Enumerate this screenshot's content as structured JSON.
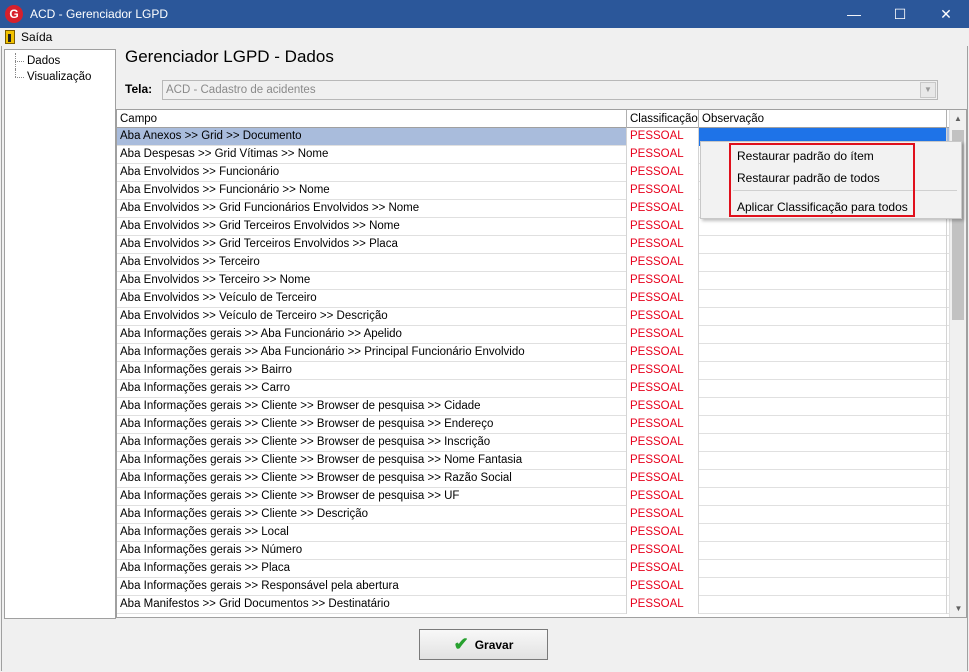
{
  "window": {
    "title": "ACD - Gerenciador LGPD",
    "minimize_glyph": "—",
    "maximize_glyph": "☐",
    "close_glyph": "✕"
  },
  "menu": {
    "exit_label": "Saída"
  },
  "tree": {
    "items": [
      "Dados",
      "Visualização"
    ]
  },
  "header": {
    "title": "Gerenciador LGPD - Dados",
    "tela_label": "Tela:",
    "tela_value": "ACD - Cadastro de acidentes"
  },
  "grid": {
    "columns": [
      "Campo",
      "Classificação",
      "Observação"
    ],
    "rows": [
      {
        "campo": "Aba Anexos >> Grid >> Documento",
        "classificacao": "PESSOAL",
        "observacao": ""
      },
      {
        "campo": "Aba Despesas >> Grid Vítimas >> Nome",
        "classificacao": "PESSOAL",
        "observacao": ""
      },
      {
        "campo": "Aba Envolvidos >> Funcionário",
        "classificacao": "PESSOAL",
        "observacao": ""
      },
      {
        "campo": "Aba Envolvidos >> Funcionário >> Nome",
        "classificacao": "PESSOAL",
        "observacao": ""
      },
      {
        "campo": "Aba Envolvidos >> Grid Funcionários Envolvidos >> Nome",
        "classificacao": "PESSOAL",
        "observacao": ""
      },
      {
        "campo": "Aba Envolvidos >> Grid Terceiros Envolvidos >> Nome",
        "classificacao": "PESSOAL",
        "observacao": ""
      },
      {
        "campo": "Aba Envolvidos >> Grid Terceiros Envolvidos >> Placa",
        "classificacao": "PESSOAL",
        "observacao": ""
      },
      {
        "campo": "Aba Envolvidos >> Terceiro",
        "classificacao": "PESSOAL",
        "observacao": ""
      },
      {
        "campo": "Aba Envolvidos >> Terceiro >> Nome",
        "classificacao": "PESSOAL",
        "observacao": ""
      },
      {
        "campo": "Aba Envolvidos >> Veículo de Terceiro",
        "classificacao": "PESSOAL",
        "observacao": ""
      },
      {
        "campo": "Aba Envolvidos >> Veículo de Terceiro >> Descrição",
        "classificacao": "PESSOAL",
        "observacao": ""
      },
      {
        "campo": "Aba Informações gerais >> Aba Funcionário >> Apelido",
        "classificacao": "PESSOAL",
        "observacao": ""
      },
      {
        "campo": "Aba Informações gerais >> Aba Funcionário >> Principal Funcionário Envolvido",
        "classificacao": "PESSOAL",
        "observacao": ""
      },
      {
        "campo": "Aba Informações gerais >> Bairro",
        "classificacao": "PESSOAL",
        "observacao": ""
      },
      {
        "campo": "Aba Informações gerais >> Carro",
        "classificacao": "PESSOAL",
        "observacao": ""
      },
      {
        "campo": "Aba Informações gerais >> Cliente >> Browser de pesquisa >> Cidade",
        "classificacao": "PESSOAL",
        "observacao": ""
      },
      {
        "campo": "Aba Informações gerais >> Cliente >> Browser de pesquisa >> Endereço",
        "classificacao": "PESSOAL",
        "observacao": ""
      },
      {
        "campo": "Aba Informações gerais >> Cliente >> Browser de pesquisa >> Inscrição",
        "classificacao": "PESSOAL",
        "observacao": ""
      },
      {
        "campo": "Aba Informações gerais >> Cliente >> Browser de pesquisa >> Nome Fantasia",
        "classificacao": "PESSOAL",
        "observacao": ""
      },
      {
        "campo": "Aba Informações gerais >> Cliente >> Browser de pesquisa >> Razão Social",
        "classificacao": "PESSOAL",
        "observacao": ""
      },
      {
        "campo": "Aba Informações gerais >> Cliente >> Browser de pesquisa >> UF",
        "classificacao": "PESSOAL",
        "observacao": ""
      },
      {
        "campo": "Aba Informações gerais >> Cliente >> Descrição",
        "classificacao": "PESSOAL",
        "observacao": ""
      },
      {
        "campo": "Aba Informações gerais >> Local",
        "classificacao": "PESSOAL",
        "observacao": ""
      },
      {
        "campo": "Aba Informações gerais >> Número",
        "classificacao": "PESSOAL",
        "observacao": ""
      },
      {
        "campo": "Aba Informações gerais >> Placa",
        "classificacao": "PESSOAL",
        "observacao": ""
      },
      {
        "campo": "Aba Informações gerais >> Responsável pela abertura",
        "classificacao": "PESSOAL",
        "observacao": ""
      },
      {
        "campo": "Aba Manifestos >> Grid Documentos >> Destinatário",
        "classificacao": "PESSOAL",
        "observacao": ""
      }
    ]
  },
  "context_menu": {
    "items": [
      "Restaurar padrão do ítem",
      "Restaurar padrão de todos",
      "Aplicar Classificação para todos"
    ]
  },
  "footer": {
    "save_label": "Gravar"
  },
  "colors": {
    "titlebar": "#2b579a",
    "selected_row": "#a9bcdc",
    "selected_cell": "#1e73e8",
    "classification_text": "#e8001c",
    "highlight_box": "#e0101c",
    "check": "#27a12f"
  }
}
